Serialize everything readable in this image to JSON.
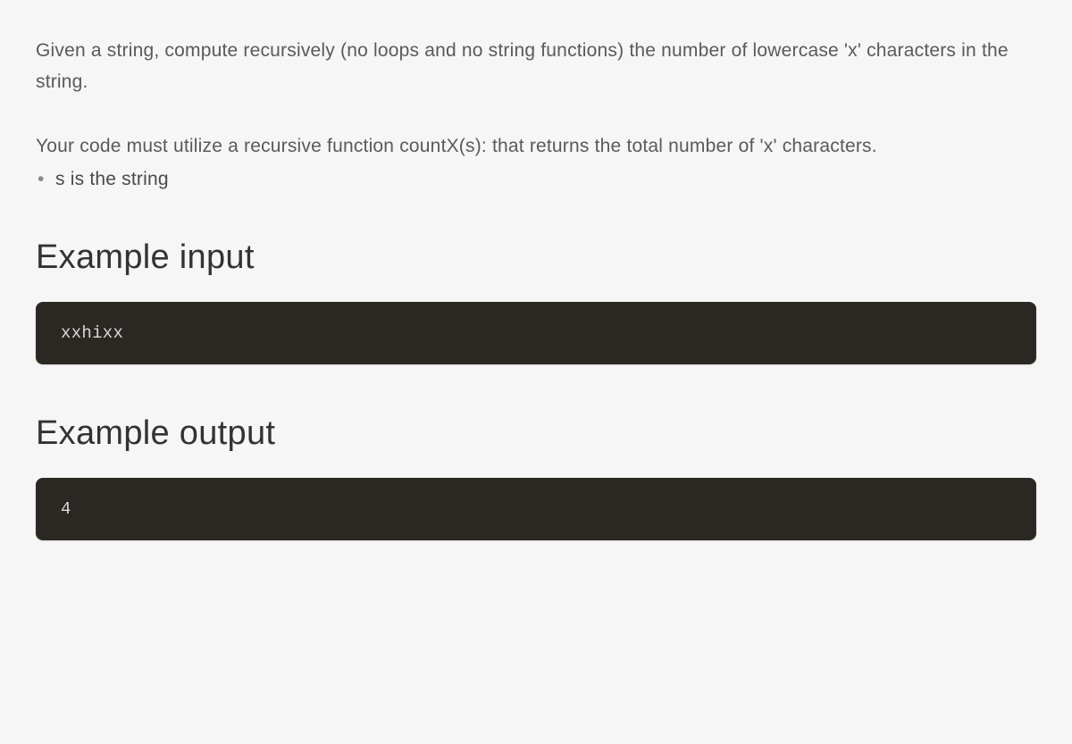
{
  "problem": {
    "description": "Given a string, compute recursively (no loops and no string functions) the number of lowercase 'x' characters in the string.",
    "instruction": "Your code must utilize a recursive function countX(s): that returns the total number of 'x' characters.",
    "bullets": [
      "s is the string"
    ]
  },
  "example_input": {
    "heading": "Example input",
    "code": "xxhixx"
  },
  "example_output": {
    "heading": "Example output",
    "code": "4"
  }
}
